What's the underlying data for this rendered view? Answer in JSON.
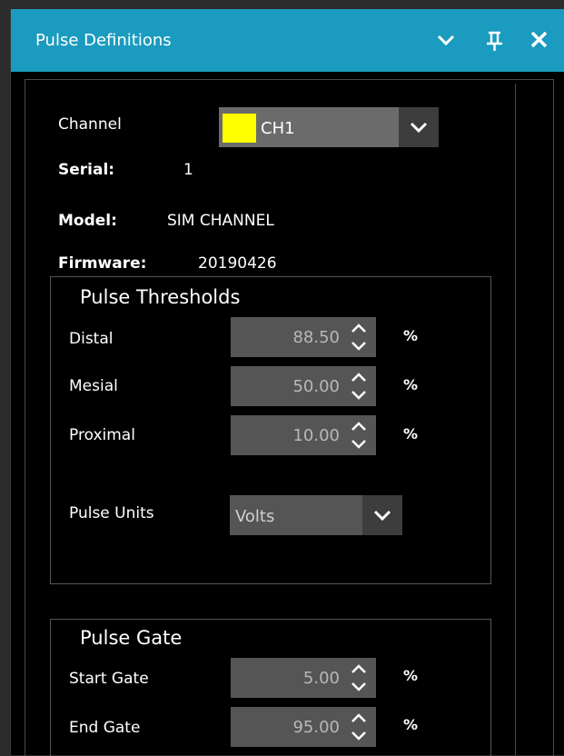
{
  "window": {
    "title": "Pulse Definitions",
    "buttons": {
      "dropdown_icon": "chevron-down-icon",
      "pin_icon": "pin-icon",
      "close_icon": "close-icon"
    }
  },
  "channel": {
    "label": "Channel",
    "selected": "CH1",
    "swatch_color": "#ffff00"
  },
  "info": {
    "serial_label": "Serial:",
    "serial_value": "1",
    "model_label": "Model:",
    "model_value": "SIM CHANNEL",
    "firmware_label": "Firmware:",
    "firmware_value": "20190426"
  },
  "thresholds": {
    "title": "Pulse Thresholds",
    "distal_label": "Distal",
    "distal_value": "88.50",
    "distal_unit": "%",
    "mesial_label": "Mesial",
    "mesial_value": "50.00",
    "mesial_unit": "%",
    "proximal_label": "Proximal",
    "proximal_value": "10.00",
    "proximal_unit": "%",
    "units_label": "Pulse Units",
    "units_value": "Volts"
  },
  "gate": {
    "title": "Pulse Gate",
    "start_label": "Start Gate",
    "start_value": "5.00",
    "start_unit": "%",
    "end_label": "End Gate",
    "end_value": "95.00",
    "end_unit": "%"
  },
  "colors": {
    "titlebar": "#1a9bbf",
    "background": "#000000",
    "field": "#555555",
    "combo": "#6b6b6b"
  }
}
